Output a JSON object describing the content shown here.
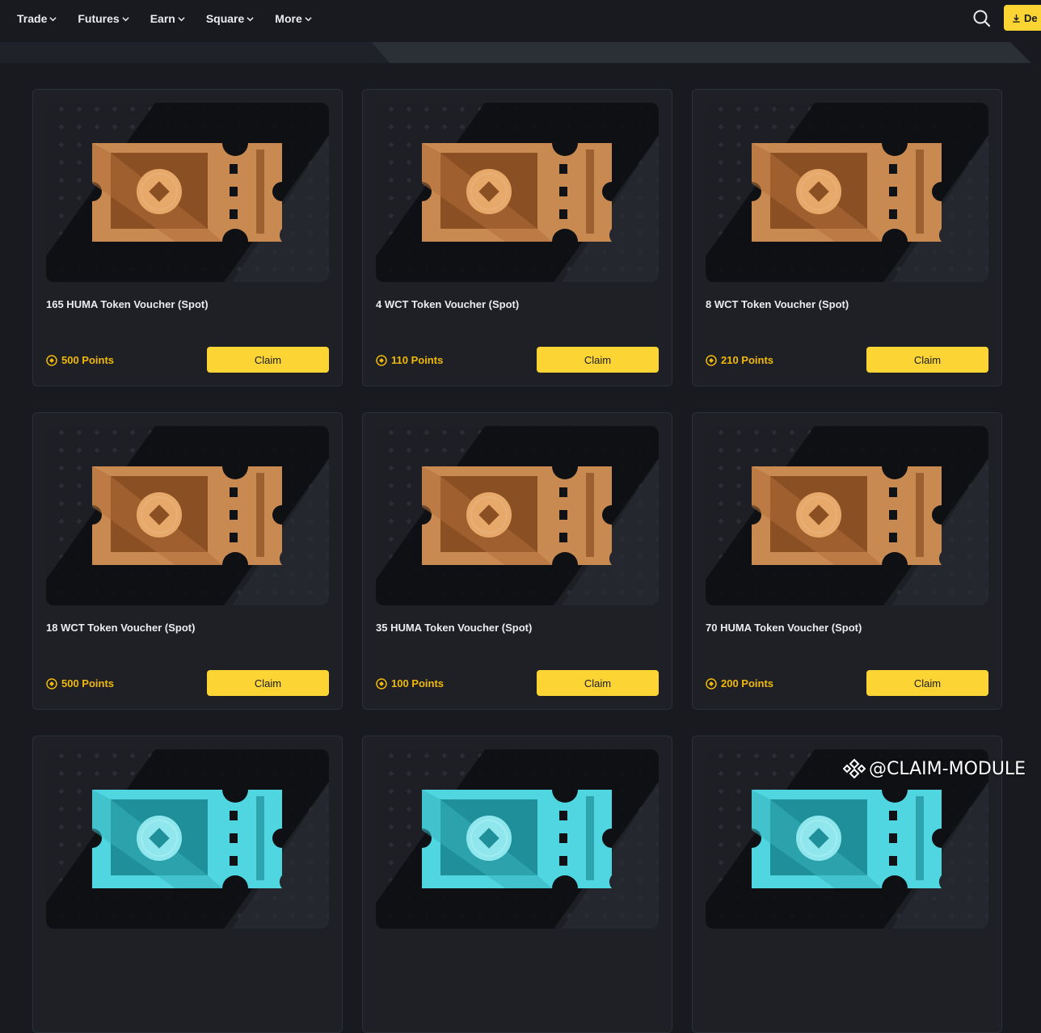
{
  "nav": {
    "items": [
      {
        "label": "Trade"
      },
      {
        "label": "Futures"
      },
      {
        "label": "Earn"
      },
      {
        "label": "Square"
      },
      {
        "label": "More"
      }
    ],
    "search_icon": "search-icon",
    "download_label": "De"
  },
  "colors": {
    "accent": "#fcd535",
    "points": "#f0b90b",
    "background": "#181a20",
    "card_border": "#2b3139",
    "voucher_bronze": "#c98a52",
    "voucher_teal": "#4fd6e0"
  },
  "cards": [
    {
      "title": "165 HUMA Token Voucher (Spot)",
      "points": "500 Points",
      "claim_label": "Claim",
      "voucher_color": "bronze"
    },
    {
      "title": "4 WCT Token Voucher (Spot)",
      "points": "110 Points",
      "claim_label": "Claim",
      "voucher_color": "bronze"
    },
    {
      "title": "8 WCT Token Voucher (Spot)",
      "points": "210 Points",
      "claim_label": "Claim",
      "voucher_color": "bronze"
    },
    {
      "title": "18 WCT Token Voucher (Spot)",
      "points": "500 Points",
      "claim_label": "Claim",
      "voucher_color": "bronze"
    },
    {
      "title": "35 HUMA Token Voucher (Spot)",
      "points": "100 Points",
      "claim_label": "Claim",
      "voucher_color": "bronze"
    },
    {
      "title": "70 HUMA Token Voucher (Spot)",
      "points": "200 Points",
      "claim_label": "Claim",
      "voucher_color": "bronze"
    },
    {
      "title": "",
      "points": "",
      "claim_label": "",
      "voucher_color": "teal"
    },
    {
      "title": "",
      "points": "",
      "claim_label": "",
      "voucher_color": "teal"
    },
    {
      "title": "",
      "points": "",
      "claim_label": "",
      "voucher_color": "teal"
    }
  ],
  "watermark": {
    "text": "@CLAIM-MODULE",
    "icon": "binance-logo-icon"
  }
}
